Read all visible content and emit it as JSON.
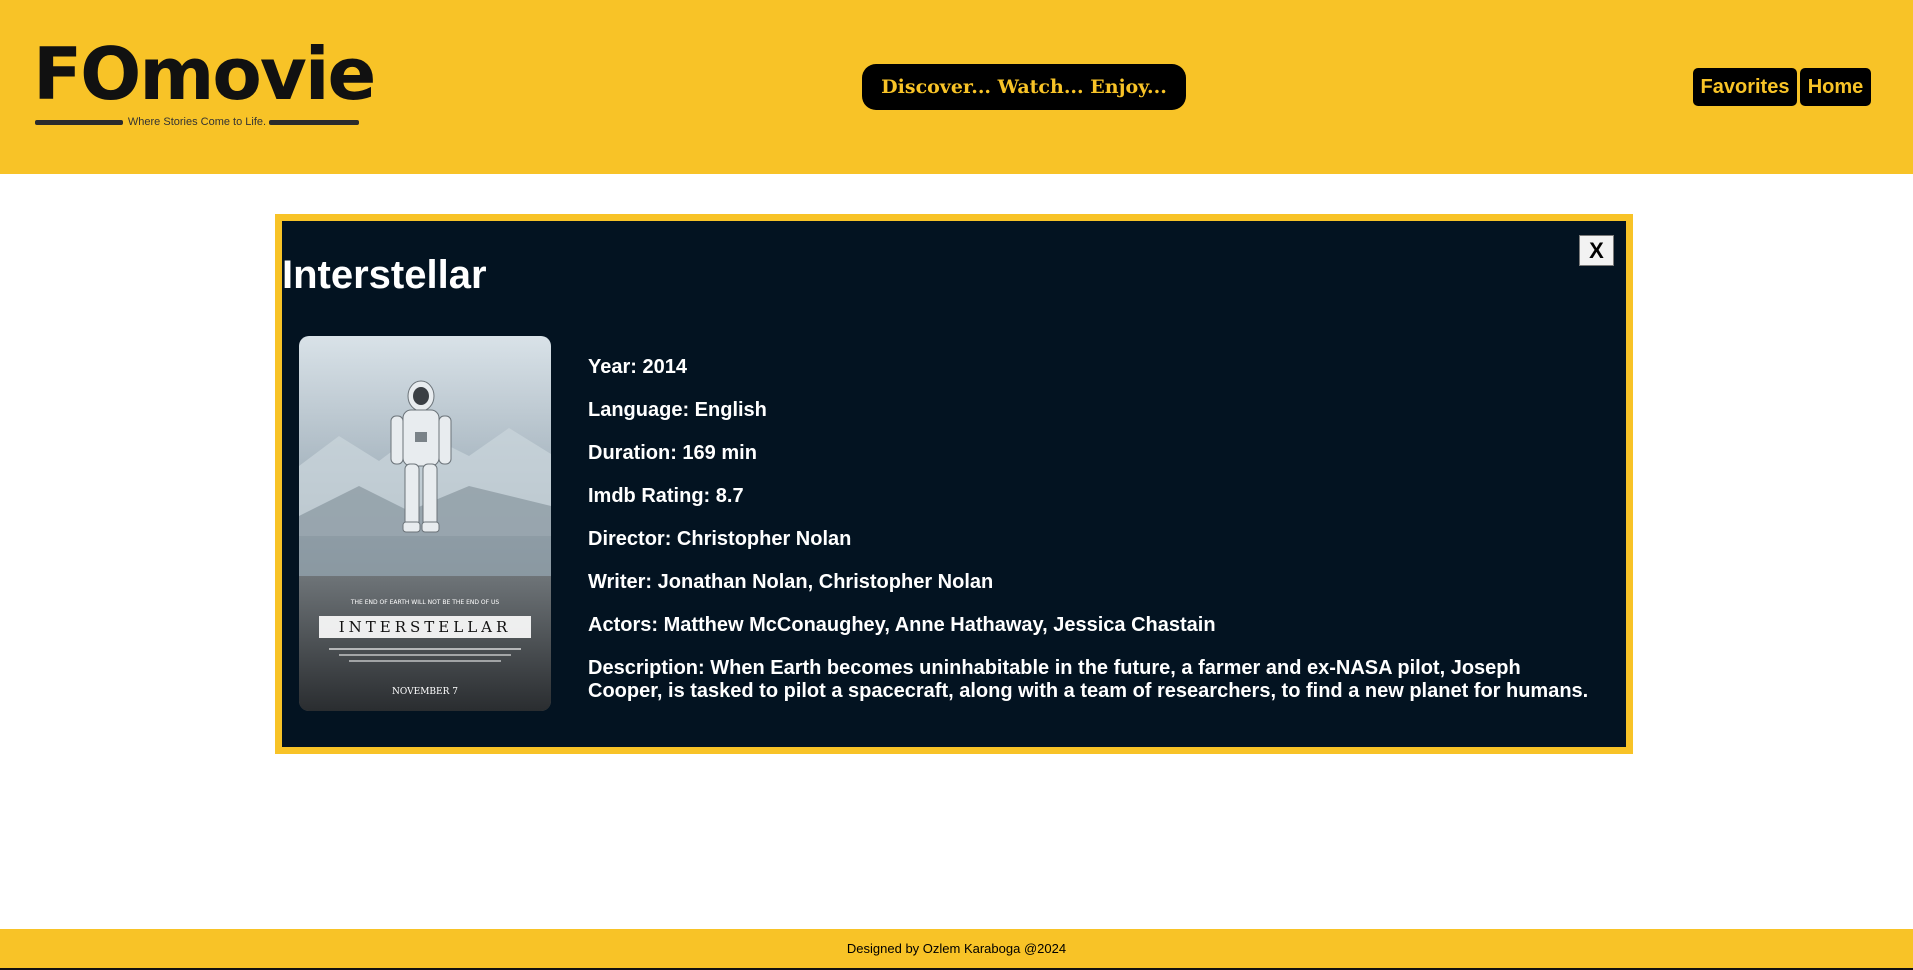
{
  "header": {
    "logo_text": "FOmovie",
    "logo_tagline": "Where Stories Come to Life.",
    "tagline": "Discover... Watch... Enjoy...",
    "nav": {
      "favorites_label": "Favorites",
      "home_label": "Home"
    }
  },
  "modal": {
    "title": "Interstellar",
    "close_label": "X",
    "poster": {
      "heading": "THE END OF EARTH WILL NOT BE THE END OF US",
      "title": "INTERSTELLAR",
      "release": "NOVEMBER 7"
    },
    "details": [
      "Year: 2014",
      "Language: English",
      "Duration: 169 min",
      "Imdb Rating: 8.7",
      "Director: Christopher Nolan",
      "Writer: Jonathan Nolan, Christopher Nolan",
      "Actors: Matthew McConaughey, Anne Hathaway, Jessica Chastain",
      "Description: When Earth becomes uninhabitable in the future, a farmer and ex-NASA pilot, Joseph Cooper, is tasked to pilot a spacecraft, along with a team of researchers, to find a new planet for humans."
    ]
  },
  "footer": {
    "text": "Designed by Ozlem Karaboga @2024"
  },
  "colors": {
    "accent": "#f8c327",
    "modal_bg": "#031321",
    "button_bg": "#000000"
  }
}
